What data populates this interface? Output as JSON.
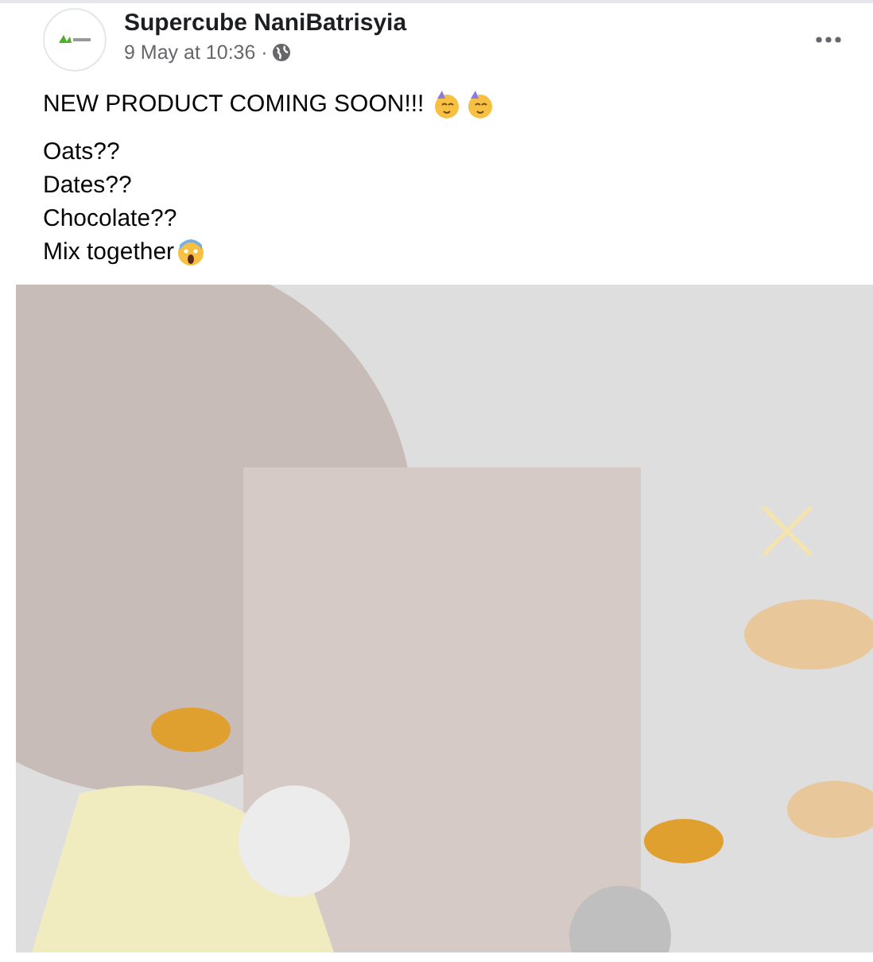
{
  "post": {
    "author": "Supercube NaniBatrisyia",
    "timestamp": "9 May at 10:36 ·",
    "headline": "NEW PRODUCT COMING SOON!!!",
    "lines": [
      "Oats??",
      "Dates??",
      "Chocolate??",
      "Mix together"
    ]
  }
}
